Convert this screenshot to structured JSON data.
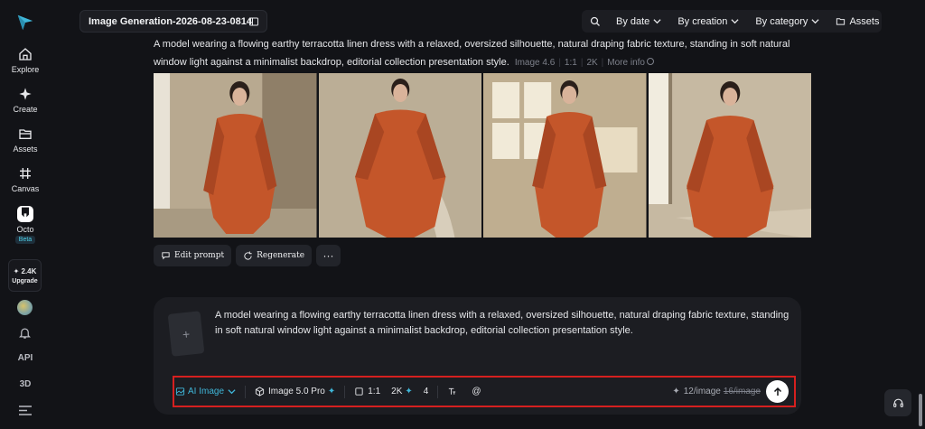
{
  "sidebar": {
    "items": [
      {
        "label": "Explore",
        "icon": "home-icon"
      },
      {
        "label": "Create",
        "icon": "sparkle-icon"
      },
      {
        "label": "Assets",
        "icon": "folder-icon"
      },
      {
        "label": "Canvas",
        "icon": "canvas-icon"
      },
      {
        "label": "Octo",
        "icon": "octo-icon"
      }
    ],
    "beta_badge": "Beta",
    "credits": "✦ 2.4K",
    "upgrade_label": "Upgrade",
    "api_label": "API",
    "three_d_label": "3D"
  },
  "header": {
    "title": "Image Generation-2026-08-23-0814",
    "filters": {
      "by_date": "By date",
      "by_creation": "By creation",
      "by_category": "By category",
      "assets": "Assets"
    }
  },
  "generation": {
    "prompt": "A model wearing a flowing earthy terracotta linen dress with a relaxed, oversized silhouette, natural draping fabric texture, standing in soft natural window light against a minimalist backdrop, editorial collection presentation style.",
    "model": "Image 4.6",
    "ratio": "1:1",
    "resolution": "2K",
    "more_info": "More info",
    "actions": {
      "edit_prompt": "Edit prompt",
      "regenerate": "Regenerate",
      "more": "···"
    }
  },
  "composer": {
    "add_symbol": "+",
    "prompt": "A model wearing a flowing earthy terracotta linen dress with a relaxed, oversized silhouette, natural draping fabric texture, standing in soft natural window light against a minimalist backdrop, editorial collection presentation style.",
    "mode": "AI Image",
    "model": "Image 5.0 Pro",
    "ratio": "1:1",
    "resolution": "2K",
    "count": "4",
    "mention": "@",
    "cost": "12/image",
    "original_cost": "16/image"
  },
  "colors": {
    "accent": "#3fb6d8",
    "dress": "#c4562a",
    "highlight_border": "#d6201f"
  }
}
